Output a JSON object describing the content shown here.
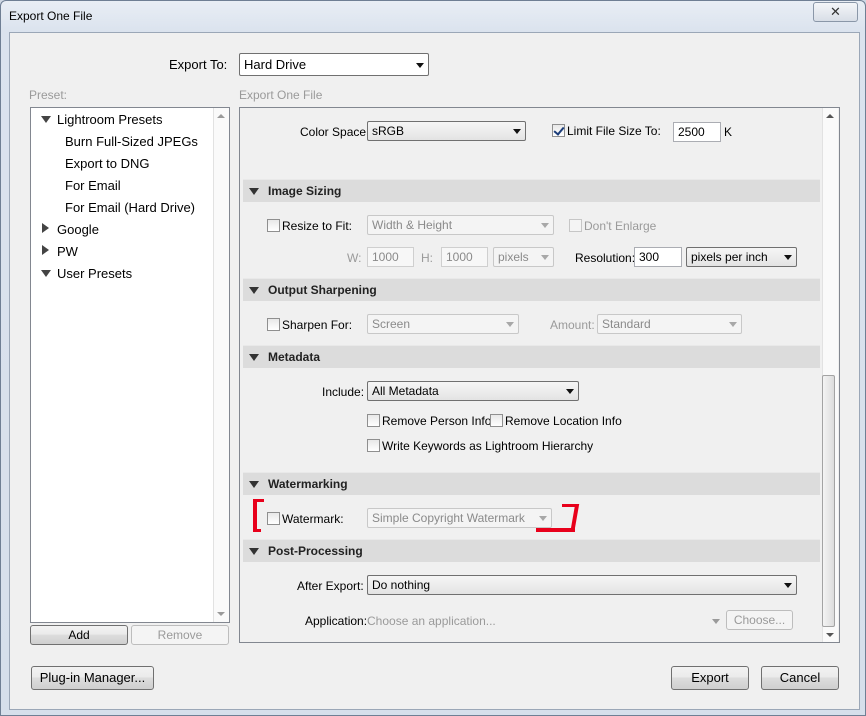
{
  "window": {
    "title": "Export One File",
    "close_glyph": "✕"
  },
  "export_to": {
    "label": "Export To:",
    "value": "Hard Drive"
  },
  "preset": {
    "label": "Preset:",
    "tree": [
      {
        "label": "Lightroom Presets",
        "expanded": true
      },
      {
        "label": "Burn Full-Sized JPEGs"
      },
      {
        "label": "Export to DNG"
      },
      {
        "label": "For Email"
      },
      {
        "label": "For Email (Hard Drive)"
      },
      {
        "label": "Google",
        "expanded": false
      },
      {
        "label": "PW",
        "expanded": false
      },
      {
        "label": "User Presets",
        "expanded": true
      }
    ],
    "add_label": "Add",
    "remove_label": "Remove"
  },
  "settings_caption": "Export One File",
  "file_settings": {
    "color_space_label": "Color Space:",
    "color_space_value": "sRGB",
    "limit_size_label": "Limit File Size To:",
    "limit_size_checked": true,
    "limit_size_value": "2500",
    "limit_size_unit": "K"
  },
  "image_sizing": {
    "title": "Image Sizing",
    "resize_label": "Resize to Fit:",
    "resize_mode": "Width & Height",
    "dont_enlarge_label": "Don't Enlarge",
    "w_label": "W:",
    "w_value": "1000",
    "h_label": "H:",
    "h_value": "1000",
    "unit": "pixels",
    "resolution_label": "Resolution:",
    "resolution_value": "300",
    "resolution_unit": "pixels per inch"
  },
  "output_sharpening": {
    "title": "Output Sharpening",
    "sharpen_label": "Sharpen For:",
    "sharpen_value": "Screen",
    "amount_label": "Amount:",
    "amount_value": "Standard"
  },
  "metadata": {
    "title": "Metadata",
    "include_label": "Include:",
    "include_value": "All Metadata",
    "remove_person_label": "Remove Person Info",
    "remove_location_label": "Remove Location Info",
    "write_keywords_label": "Write Keywords as Lightroom Hierarchy"
  },
  "watermarking": {
    "title": "Watermarking",
    "watermark_label": "Watermark:",
    "watermark_value": "Simple Copyright Watermark",
    "annotation_color": "#e8001b"
  },
  "post_processing": {
    "title": "Post-Processing",
    "after_export_label": "After Export:",
    "after_export_value": "Do nothing",
    "application_label": "Application:",
    "application_placeholder": "Choose an application...",
    "choose_label": "Choose..."
  },
  "footer": {
    "plugin_manager_label": "Plug-in Manager...",
    "export_label": "Export",
    "cancel_label": "Cancel"
  }
}
